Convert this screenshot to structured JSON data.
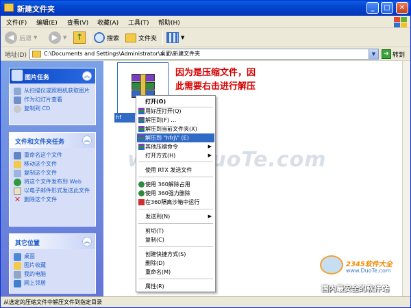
{
  "window": {
    "title": "新建文件夹"
  },
  "menubar": [
    "文件(F)",
    "编辑(E)",
    "查看(V)",
    "收藏(A)",
    "工具(T)",
    "帮助(H)"
  ],
  "toolbar": {
    "back": "后退",
    "search": "搜索",
    "folders": "文件夹"
  },
  "address": {
    "label": "地址(D)",
    "path": "C:\\Documents and Settings\\Administrator\\桌面\\新建文件夹",
    "go": "转到"
  },
  "left_panels": {
    "picture_tasks": {
      "title": "图片任务",
      "items": [
        "从扫描仪或照相机获取图片",
        "作为幻灯片查看",
        "复制到 CD"
      ]
    },
    "file_tasks": {
      "title": "文件和文件夹任务",
      "items": [
        "重命名这个文件",
        "移动这个文件",
        "复制这个文件",
        "将这个文件发布到 Web",
        "以电子邮件形式发送此文件",
        "删除这个文件"
      ]
    },
    "other_places": {
      "title": "其它位置",
      "items": [
        "桌面",
        "图片收藏",
        "我的电脑",
        "网上邻居"
      ]
    }
  },
  "file": {
    "label": "hf"
  },
  "note": [
    "因为是压缩文件，因",
    "此需要右击进行解压"
  ],
  "context_menu": {
    "items": [
      {
        "label": "打开(O)",
        "bold": true
      },
      {
        "label": "用好压打开(Q)",
        "icon": true
      },
      {
        "label": "解压到(F) ...",
        "icon": true
      },
      {
        "label": "解压到当前文件夹(X)",
        "icon": true
      },
      {
        "label": "解压到 \"hfrj\\\" (E)",
        "icon": true,
        "selected": true
      },
      {
        "label": "其他压缩命令",
        "icon": true,
        "submenu": true
      },
      {
        "label": "打开方式(H)",
        "submenu": true
      },
      {
        "label": "使用 RTX 发送文件"
      },
      {
        "label": "使用 360解除占用",
        "icon": true
      },
      {
        "label": "使用 360强力删除",
        "icon": true
      },
      {
        "label": "在360隔离沙箱中运行",
        "icon": true
      },
      {
        "label": "发送到(N)",
        "submenu": true
      },
      {
        "label": "剪切(T)"
      },
      {
        "label": "复制(C)"
      },
      {
        "label": "创建快捷方式(S)"
      },
      {
        "label": "删除(D)"
      },
      {
        "label": "重命名(M)"
      },
      {
        "label": "属性(R)"
      }
    ]
  },
  "watermark": {
    "text": "www.DuoTe.com",
    "brand": "2345软件大全",
    "url": "www.DuoTe.com",
    "tagline": "国内最安全的软件站"
  },
  "status": {
    "text": "从选定的压缩文件中解压文件到指定目录"
  },
  "colors": {
    "title_blue": "#0545d0",
    "selection": "#316ac5",
    "note_red": "#d40000",
    "panel_bg": "#d6dff7"
  }
}
